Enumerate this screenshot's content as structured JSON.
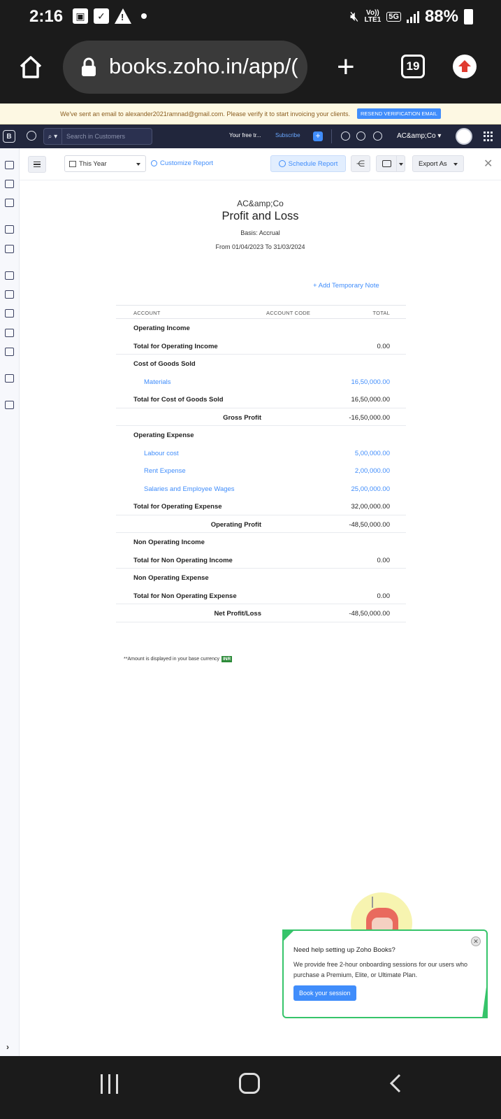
{
  "status_bar": {
    "time": "2:16",
    "volte_top": "Vo))",
    "volte_bottom": "LTE1",
    "network": "5G",
    "battery": "88%"
  },
  "browser": {
    "url": "books.zoho.in/app/(",
    "tab_count": "19"
  },
  "notice": {
    "text": "We've sent an email to alexander2021ramnad@gmail.com. Please verify it to start invoicing your clients.",
    "button": "RESEND VERIFICATION EMAIL"
  },
  "topnav": {
    "search_placeholder": "Search in Customers",
    "trial_text": "Your free tr...",
    "subscribe": "Subscribe",
    "org": "AC&amp;Co"
  },
  "toolbar": {
    "period": "This Year",
    "customize": "Customize Report",
    "schedule": "Schedule Report",
    "export": "Export As"
  },
  "report": {
    "org_name": "AC&amp;Co",
    "title": "Profit and Loss",
    "basis": "Basis: Accrual",
    "range": "From 01/04/2023 To 31/03/2024",
    "add_note": "+ Add Temporary Note",
    "columns": {
      "account": "ACCOUNT",
      "code": "ACCOUNT CODE",
      "total": "TOTAL"
    },
    "rows": [
      {
        "label": "Operating Income",
        "amount": "",
        "style": "section"
      },
      {
        "label": "Total for Operating Income",
        "amount": "0.00",
        "style": "total"
      },
      {
        "label": "Cost of Goods Sold",
        "amount": "",
        "style": "section"
      },
      {
        "label": "Materials",
        "amount": "16,50,000.00",
        "style": "sub"
      },
      {
        "label": "Total for Cost of Goods Sold",
        "amount": "16,50,000.00",
        "style": "total"
      },
      {
        "label": "Gross Profit",
        "amount": "-16,50,000.00",
        "style": "summary"
      },
      {
        "label": "Operating Expense",
        "amount": "",
        "style": "section"
      },
      {
        "label": "Labour cost",
        "amount": "5,00,000.00",
        "style": "sub"
      },
      {
        "label": "Rent Expense",
        "amount": "2,00,000.00",
        "style": "sub"
      },
      {
        "label": "Salaries and Employee Wages",
        "amount": "25,00,000.00",
        "style": "sub"
      },
      {
        "label": "Total for Operating Expense",
        "amount": "32,00,000.00",
        "style": "total"
      },
      {
        "label": "Operating Profit",
        "amount": "-48,50,000.00",
        "style": "summary"
      },
      {
        "label": "Non Operating Income",
        "amount": "",
        "style": "section"
      },
      {
        "label": "Total for Non Operating Income",
        "amount": "0.00",
        "style": "total"
      },
      {
        "label": "Non Operating Expense",
        "amount": "",
        "style": "section"
      },
      {
        "label": "Total for Non Operating Expense",
        "amount": "0.00",
        "style": "total"
      },
      {
        "label": "Net Profit/Loss",
        "amount": "-48,50,000.00",
        "style": "summary"
      }
    ],
    "footnote": "**Amount is displayed in your base currency",
    "currency": "INR"
  },
  "help_popup": {
    "title": "Need help setting up Zoho Books?",
    "body": "We provide free 2-hour onboarding sessions for our users who purchase a Premium, Elite, or Ultimate Plan.",
    "button": "Book your session"
  },
  "colors": {
    "accent": "#408dfb",
    "topnav": "#21263c",
    "popup_border": "#36c46a",
    "currency_badge": "#2e8b3a"
  }
}
